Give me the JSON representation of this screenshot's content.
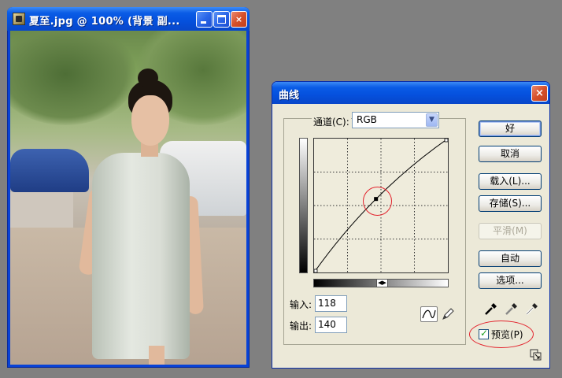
{
  "document_window": {
    "title": "夏至.jpg @ 100% (背景 副...",
    "buttons": {
      "minimize": "minimize-icon",
      "maximize": "maximize-icon",
      "close": "×"
    }
  },
  "curves_dialog": {
    "title": "曲线",
    "close_glyph": "×",
    "channel_label": "通道(C):",
    "channel_value": "RGB",
    "input_label": "输入:",
    "input_value": "118",
    "output_label": "输出:",
    "output_value": "140",
    "buttons": {
      "ok": "好",
      "cancel": "取消",
      "load": "载入(L)...",
      "save": "存储(S)...",
      "smooth": "平滑(M)",
      "auto": "自动",
      "options": "选项..."
    },
    "preview_label": "预览(P)",
    "preview_checked": true,
    "curve": {
      "control_point": {
        "input": 118,
        "output": 140
      },
      "grid_divisions": 4,
      "range": [
        0,
        255
      ]
    },
    "highlight_color": "#e3232d",
    "icons": [
      "curve-tool-icon",
      "pencil-tool-icon",
      "black-eyedropper-icon",
      "gray-eyedropper-icon",
      "white-eyedropper-icon",
      "resize-grip-icon"
    ]
  }
}
